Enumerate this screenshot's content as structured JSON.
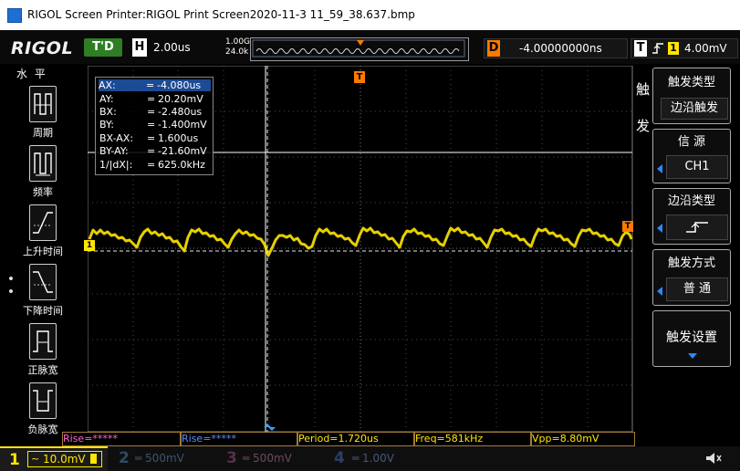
{
  "window": {
    "title": "RIGOL Screen Printer:RIGOL Print Screen2020-11-3 11_59_38.637.bmp"
  },
  "topbar": {
    "logo": "RIGOL",
    "run_state": "T'D",
    "timebase_label": "H",
    "timebase_value": "2.00us",
    "sample_rate": "1.00GSa/s",
    "memory_depth": "24.0k pts",
    "delay_label": "D",
    "delay_value": "-4.00000000ns",
    "trigger_label": "T",
    "trigger_source": "1",
    "trigger_level": "4.00mV"
  },
  "left_menu": {
    "title": "水 平",
    "items": [
      {
        "label": "周期",
        "icon": "period-icon"
      },
      {
        "label": "频率",
        "icon": "frequency-icon"
      },
      {
        "label": "上升时间",
        "icon": "rise-time-icon"
      },
      {
        "label": "下降时间",
        "icon": "fall-time-icon"
      },
      {
        "label": "正脉宽",
        "icon": "positive-width-icon"
      },
      {
        "label": "负脉宽",
        "icon": "negative-width-icon"
      }
    ]
  },
  "cursor_readout": [
    {
      "key": "AX:",
      "eq": "=",
      "value": "-4.080us"
    },
    {
      "key": "AY:",
      "eq": "=",
      "value": "20.20mV"
    },
    {
      "key": "BX:",
      "eq": "=",
      "value": "-2.480us"
    },
    {
      "key": "BY:",
      "eq": "=",
      "value": "-1.400mV"
    },
    {
      "key": "BX-AX:",
      "eq": "=",
      "value": "1.600us"
    },
    {
      "key": "BY-AY:",
      "eq": "=",
      "value": "-21.60mV"
    },
    {
      "key": "1/|dX|:",
      "eq": "=",
      "value": "625.0kHz"
    }
  ],
  "markers": {
    "trigger_position": "T",
    "trigger_level": "T",
    "channel1": "1"
  },
  "right_menu": {
    "title": "触发",
    "trigger_type_label": "触发类型",
    "trigger_type_value": "边沿触发",
    "source_label": "信 源",
    "source_value": "CH1",
    "edge_type_label": "边沿类型",
    "trigger_mode_label": "触发方式",
    "trigger_mode_value": "普 通",
    "trigger_setup_label": "触发设置"
  },
  "measurements": [
    {
      "text": "Rise=*****",
      "color": "#ff66cc"
    },
    {
      "text": "Rise=*****",
      "color": "#5a8cff"
    },
    {
      "text": "Period=1.720us",
      "color": "#ffe600"
    },
    {
      "text": "Freq=581kHz",
      "color": "#ffe600"
    },
    {
      "text": "Vpp=8.80mV",
      "color": "#ffe600"
    }
  ],
  "channels": [
    {
      "num": "1",
      "value": "10.0mV",
      "color": "#ffe600",
      "active": true
    },
    {
      "num": "2",
      "value": "500mV",
      "color": "#39a0ff",
      "active": false
    },
    {
      "num": "3",
      "value": "500mV",
      "color": "#ff3cc8",
      "active": false
    },
    {
      "num": "4",
      "value": "1.00V",
      "color": "#2f74ff",
      "active": false
    }
  ],
  "colors": {
    "trace": "#ffe600",
    "accent": "#ff7a00",
    "menu_highlight": "#2a88ff"
  }
}
